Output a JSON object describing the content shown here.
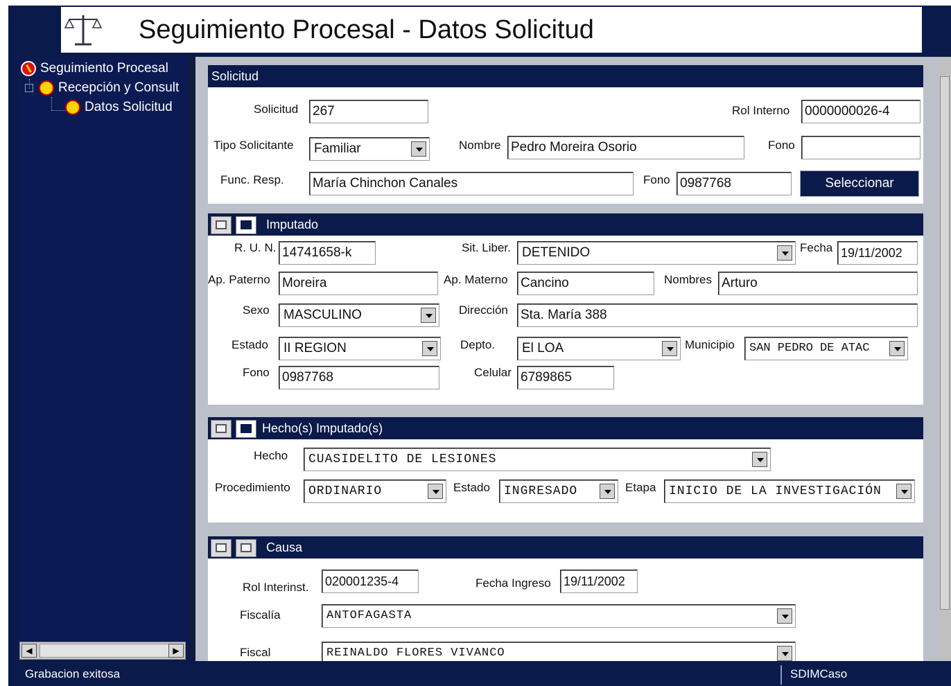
{
  "window": {
    "title": "Seguimiento Procesal  -  Datos Solicitud"
  },
  "tree": {
    "items": [
      {
        "label": "Seguimiento Procesal",
        "icon": "no-entry-icon"
      },
      {
        "label": "Recepción y Consult",
        "icon": "folder-icon"
      },
      {
        "label": "Datos Solicitud",
        "icon": "folder-icon"
      }
    ]
  },
  "solicitud": {
    "header": "Solicitud",
    "solicitud_label": "Solicitud",
    "solicitud_value": "267",
    "rol_interno_label": "Rol Interno",
    "rol_interno_value": "0000000026-4",
    "tipo_label": "Tipo Solicitante",
    "tipo_value": "Familiar",
    "nombre_label": "Nombre",
    "nombre_value": "Pedro Moreira Osorio",
    "fono_label": "Fono",
    "fono_value": "",
    "func_label": "Func. Resp.",
    "func_value": "María Chinchon Canales",
    "fono2_label": "Fono",
    "fono2_value": "0987768",
    "seleccionar": "Seleccionar"
  },
  "imputado": {
    "header": "Imputado",
    "run_label": "R. U. N.",
    "run_value": "14741658-k",
    "sit_label": "Sit. Liber.",
    "sit_value": "DETENIDO",
    "fecha_label": "Fecha",
    "fecha_value": "19/11/2002",
    "paterno_label": "Ap. Paterno",
    "paterno_value": "Moreira",
    "materno_label": "Ap. Materno",
    "materno_value": "Cancino",
    "nombres_label": "Nombres",
    "nombres_value": "Arturo",
    "sexo_label": "Sexo",
    "sexo_value": "MASCULINO",
    "direccion_label": "Dirección",
    "direccion_value": "Sta. María 388",
    "estado_label": "Estado",
    "estado_value": "II REGION",
    "depto_label": "Depto.",
    "depto_value": "El LOA",
    "municipio_label": "Municipio",
    "municipio_value": "SAN PEDRO DE ATAC",
    "fono_label": "Fono",
    "fono_value": "0987768",
    "celular_label": "Celular",
    "celular_value": "6789865"
  },
  "hechos": {
    "header": "Hecho(s) Imputado(s)",
    "hecho_label": "Hecho",
    "hecho_value": "CUASIDELITO DE LESIONES",
    "proc_label": "Procedimiento",
    "proc_value": "ORDINARIO",
    "estado_label": "Estado",
    "estado_value": "INGRESADO",
    "etapa_label": "Etapa",
    "etapa_value": "INICIO DE LA INVESTIGACIÓN"
  },
  "causa": {
    "header": "Causa",
    "rol_label": "Rol Interinst.",
    "rol_value": "020001235-4",
    "fecha_label": "Fecha Ingreso",
    "fecha_value": "19/11/2002",
    "fiscalia_label": "Fiscalía",
    "fiscalia_value": "ANTOFAGASTA",
    "fiscal_label": "Fiscal",
    "fiscal_value": "REINALDO FLORES VIVANCO"
  },
  "status": {
    "message": "Grabacion exitosa",
    "app": "SDIMCaso"
  }
}
